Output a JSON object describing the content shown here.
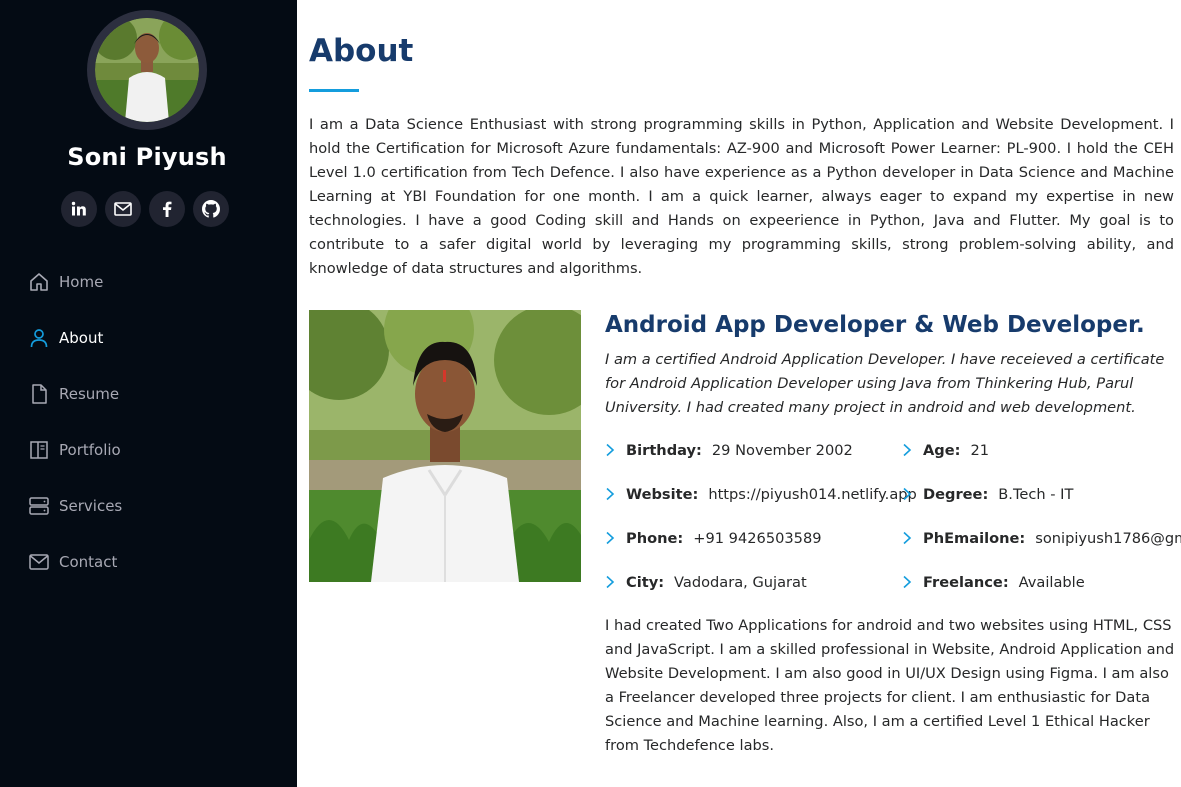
{
  "profile": {
    "name": "Soni Piyush",
    "avatar_icon": "person-photo"
  },
  "social": [
    {
      "icon": "linkedin-icon",
      "label": "in"
    },
    {
      "icon": "mail-icon",
      "label": "mail"
    },
    {
      "icon": "facebook-icon",
      "label": "f"
    },
    {
      "icon": "github-icon",
      "label": "github"
    }
  ],
  "nav": {
    "items": [
      {
        "label": "Home",
        "icon": "home-icon",
        "active": false
      },
      {
        "label": "About",
        "icon": "person-icon",
        "active": true
      },
      {
        "label": "Resume",
        "icon": "file-icon",
        "active": false
      },
      {
        "label": "Portfolio",
        "icon": "book-icon",
        "active": false
      },
      {
        "label": "Services",
        "icon": "server-icon",
        "active": false
      },
      {
        "label": "Contact",
        "icon": "envelope-icon",
        "active": false
      }
    ]
  },
  "about": {
    "title": "About",
    "intro": "I am a Data Science Enthusiast with strong programming skills in Python, Application and Website Development. I hold the Certification for Microsoft Azure fundamentals: AZ-900 and Microsoft Power Learner: PL-900. I hold the CEH Level 1.0 certification from Tech Defence. I also have experience as a Python developer in Data Science and Machine Learning at YBI Foundation for one month. I am a quick learner, always eager to expand my expertise in new technologies. I have a good Coding skill and Hands on expeerience in Python, Java and Flutter. My goal is to contribute to a safer digital world by leveraging my programming skills, strong problem-solving ability, and knowledge of data structures and algorithms.",
    "role_title": "Android App Developer & Web Developer.",
    "role_desc": "I am a certified Android Application Developer. I have receieved a certificate for Android Application Developer using Java from Thinkering Hub, Parul University. I had created many project in android and web development.",
    "facts": [
      {
        "label": "Birthday:",
        "value": "29 November 2002"
      },
      {
        "label": "Age:",
        "value": "21"
      },
      {
        "label": "Website:",
        "value": "https://piyush014.netlify.app"
      },
      {
        "label": "Degree:",
        "value": "B.Tech - IT"
      },
      {
        "label": "Phone:",
        "value": "+91 9426503589"
      },
      {
        "label": "PhEmailone:",
        "value": "sonipiyush1786@gm"
      },
      {
        "label": "City:",
        "value": "Vadodara, Gujarat"
      },
      {
        "label": "Freelance:",
        "value": "Available"
      }
    ],
    "extra": "I had created Two Applications for android and two websites using HTML, CSS and JavaScript. I am a skilled professional in Website, Android Application and Website Development. I am also good in UI/UX Design using Figma. I am also a Freelancer developed three projects for client. I am enthusiastic for Data Science and Machine learning. Also, I am a certified Level 1 Ethical Hacker from Techdefence labs."
  },
  "colors": {
    "sidebar_bg": "#040b14",
    "accent": "#149ddd",
    "heading": "#173b6c",
    "nav_text": "#a8a9b4"
  }
}
